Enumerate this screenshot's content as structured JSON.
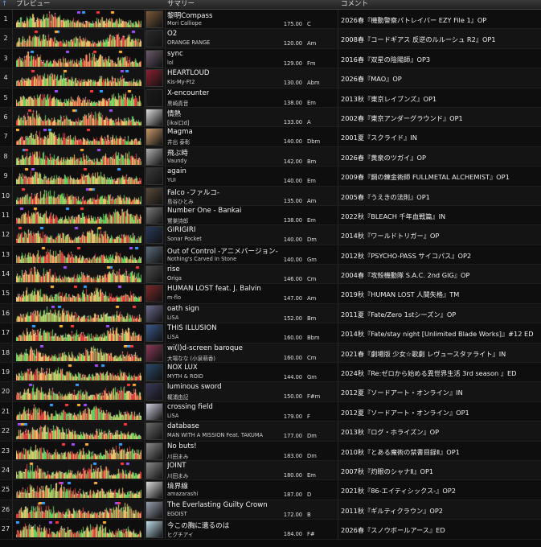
{
  "header": {
    "sort_arrow": "↑",
    "preview_label": "プレビュー",
    "summary_label": "サマリー",
    "comment_label": "コメント"
  },
  "rows": [
    {
      "num": "1",
      "title": "黎明Compass",
      "artist": "Mori Calliope",
      "bpm": "175.00",
      "key": "C",
      "comment": "2026春『機動警察パトレイバー EZY File 1』OP",
      "thumb_color": "#7a5a3a"
    },
    {
      "num": "2",
      "title": "O2",
      "artist": "ORANGE RANGE",
      "bpm": "120.00",
      "key": "Am",
      "comment": "2008春『コードギアス 反逆のルルーシュ R2』OP1",
      "thumb_color": "#2a2a2a"
    },
    {
      "num": "3",
      "title": "sync",
      "artist": "lol",
      "bpm": "129.00",
      "key": "Fm",
      "comment": "2016春『双星の陰陽師』OP3",
      "thumb_color": "#6a5a6a"
    },
    {
      "num": "4",
      "title": "HEARTLOUD",
      "artist": "Kis-My-Ft2",
      "bpm": "130.00",
      "key": "Abm",
      "comment": "2026春『MAO』OP",
      "thumb_color": "#8a2030"
    },
    {
      "num": "5",
      "title": "X-encounter",
      "artist": "黒崎真音",
      "bpm": "138.00",
      "key": "Em",
      "comment": "2013秋『東京レイブンズ』OP1",
      "thumb_color": "#1a1a1a"
    },
    {
      "num": "6",
      "title": "情熱",
      "artist": "[ikai口d]",
      "bpm": "133.00",
      "key": "A",
      "comment": "2002春『東京アンダーグラウンド』OP1",
      "thumb_color": "#dcdcdc"
    },
    {
      "num": "7",
      "title": "Magma",
      "artist": "井出 泰彰",
      "bpm": "140.00",
      "key": "Dbm",
      "comment": "2001夏『スクライド』IN",
      "thumb_color": "#c89a6a"
    },
    {
      "num": "8",
      "title": "飛ぶ時",
      "artist": "Vaundy",
      "bpm": "142.00",
      "key": "Bm",
      "comment": "2026春『黄泉のツガイ』OP",
      "thumb_color": "#b0b0b0"
    },
    {
      "num": "9",
      "title": "again",
      "artist": "YUI",
      "bpm": "140.00",
      "key": "Em",
      "comment": "2009春『鋼の錬金術師 FULLMETAL ALCHEMIST』OP1",
      "thumb_color": "#3a3a3a"
    },
    {
      "num": "10",
      "title": "Falco -ファルコ-",
      "artist": "島谷ひとみ",
      "bpm": "135.00",
      "key": "Am",
      "comment": "2005春『うえきの法則』OP1",
      "thumb_color": "#5a4a3a"
    },
    {
      "num": "11",
      "title": "Number One - Bankai",
      "artist": "鷺巣詩郎",
      "bpm": "138.00",
      "key": "Em",
      "comment": "2022秋『BLEACH 千年血戦篇』IN",
      "thumb_color": "#7a7a7a"
    },
    {
      "num": "12",
      "title": "GIRIGIRI",
      "artist": "Sonar Pocket",
      "bpm": "140.00",
      "key": "Dm",
      "comment": "2014秋『ワールドトリガー』OP",
      "thumb_color": "#2a3a5a"
    },
    {
      "num": "13",
      "title": "Out of Control -アニメバージョン-",
      "artist": "Nothing's Carved In Stone",
      "bpm": "140.00",
      "key": "Gm",
      "comment": "2012秋『PSYCHO-PASS サイコパス』OP2",
      "thumb_color": "#5a6a7a"
    },
    {
      "num": "14",
      "title": "rise",
      "artist": "Origa",
      "bpm": "146.00",
      "key": "Cm",
      "comment": "2004春『攻殻機動隊 S.A.C. 2nd GIG』OP",
      "thumb_color": "#4a4a4a"
    },
    {
      "num": "15",
      "title": "HUMAN LOST feat. J. Balvin",
      "artist": "m-flo",
      "bpm": "147.00",
      "key": "Am",
      "comment": "2019秋『HUMAN LOST 人間失格』TM",
      "thumb_color": "#7a2a2a"
    },
    {
      "num": "16",
      "title": "oath sign",
      "artist": "LiSA",
      "bpm": "152.00",
      "key": "Bm",
      "comment": "2011夏『Fate/Zero 1stシーズン』OP",
      "thumb_color": "#6a6a8a"
    },
    {
      "num": "17",
      "title": "THIS ILLUSION",
      "artist": "LiSA",
      "bpm": "160.00",
      "key": "Bbm",
      "comment": "2014秋『Fate/stay night [Unlimited Blade Works]』#12 ED",
      "thumb_color": "#3a5a8a"
    },
    {
      "num": "18",
      "title": "wi(l)d-screen baroque",
      "artist": "大場なな (小泉萌香)",
      "bpm": "160.00",
      "key": "Cm",
      "comment": "2021春『劇場版 少女☆歌劇 レヴュースタァライト』IN",
      "thumb_color": "#8a3a5a"
    },
    {
      "num": "19",
      "title": "NOX LUX",
      "artist": "MYTH & ROID",
      "bpm": "144.00",
      "key": "Gm",
      "comment": "2024秋『Re:ゼロから始める異世界生活 3rd season 』ED",
      "thumb_color": "#2a4a6a"
    },
    {
      "num": "20",
      "title": "luminous sword",
      "artist": "梶浦由記",
      "bpm": "150.00",
      "key": "F#m",
      "comment": "2012夏『ソードアート・オンライン』IN",
      "thumb_color": "#3a3a5a"
    },
    {
      "num": "21",
      "title": "crossing field",
      "artist": "LiSA",
      "bpm": "179.00",
      "key": "F",
      "comment": "2012夏『ソードアート・オンライン』OP1",
      "thumb_color": "#cfcfe0"
    },
    {
      "num": "22",
      "title": "database",
      "artist": "MAN WITH A MISSION Feat. TAKUMA",
      "bpm": "177.00",
      "key": "Dm",
      "comment": "2013秋『ログ・ホライズン』OP",
      "thumb_color": "#6a6a6a"
    },
    {
      "num": "23",
      "title": "No buts!",
      "artist": "川田まみ",
      "bpm": "183.00",
      "key": "Dm",
      "comment": "2010秋『とある魔術の禁書目録Ⅱ』OP1",
      "thumb_color": "#8a8a8a"
    },
    {
      "num": "24",
      "title": "JOINT",
      "artist": "川田まみ",
      "bpm": "180.00",
      "key": "Em",
      "comment": "2007秋『灼眼のシャナⅡ』OP1",
      "thumb_color": "#8a8a8a"
    },
    {
      "num": "25",
      "title": "境界線",
      "artist": "amazarashi",
      "bpm": "187.00",
      "key": "D",
      "comment": "2021秋『86-エイティシックス-』OP2",
      "thumb_color": "#dcdcdc"
    },
    {
      "num": "26",
      "title": "The Everlasting Guilty Crown",
      "artist": "EGOIST",
      "bpm": "172.00",
      "key": "B",
      "comment": "2011秋『ギルティクラウン』OP2",
      "thumb_color": "#9aa0b0"
    },
    {
      "num": "27",
      "title": "今この胸に遺るのは",
      "artist": "ヒグチアイ",
      "bpm": "184.00",
      "key": "F#",
      "comment": "2026春『スノウボールアース』ED",
      "thumb_color": "#c0dce8"
    }
  ]
}
